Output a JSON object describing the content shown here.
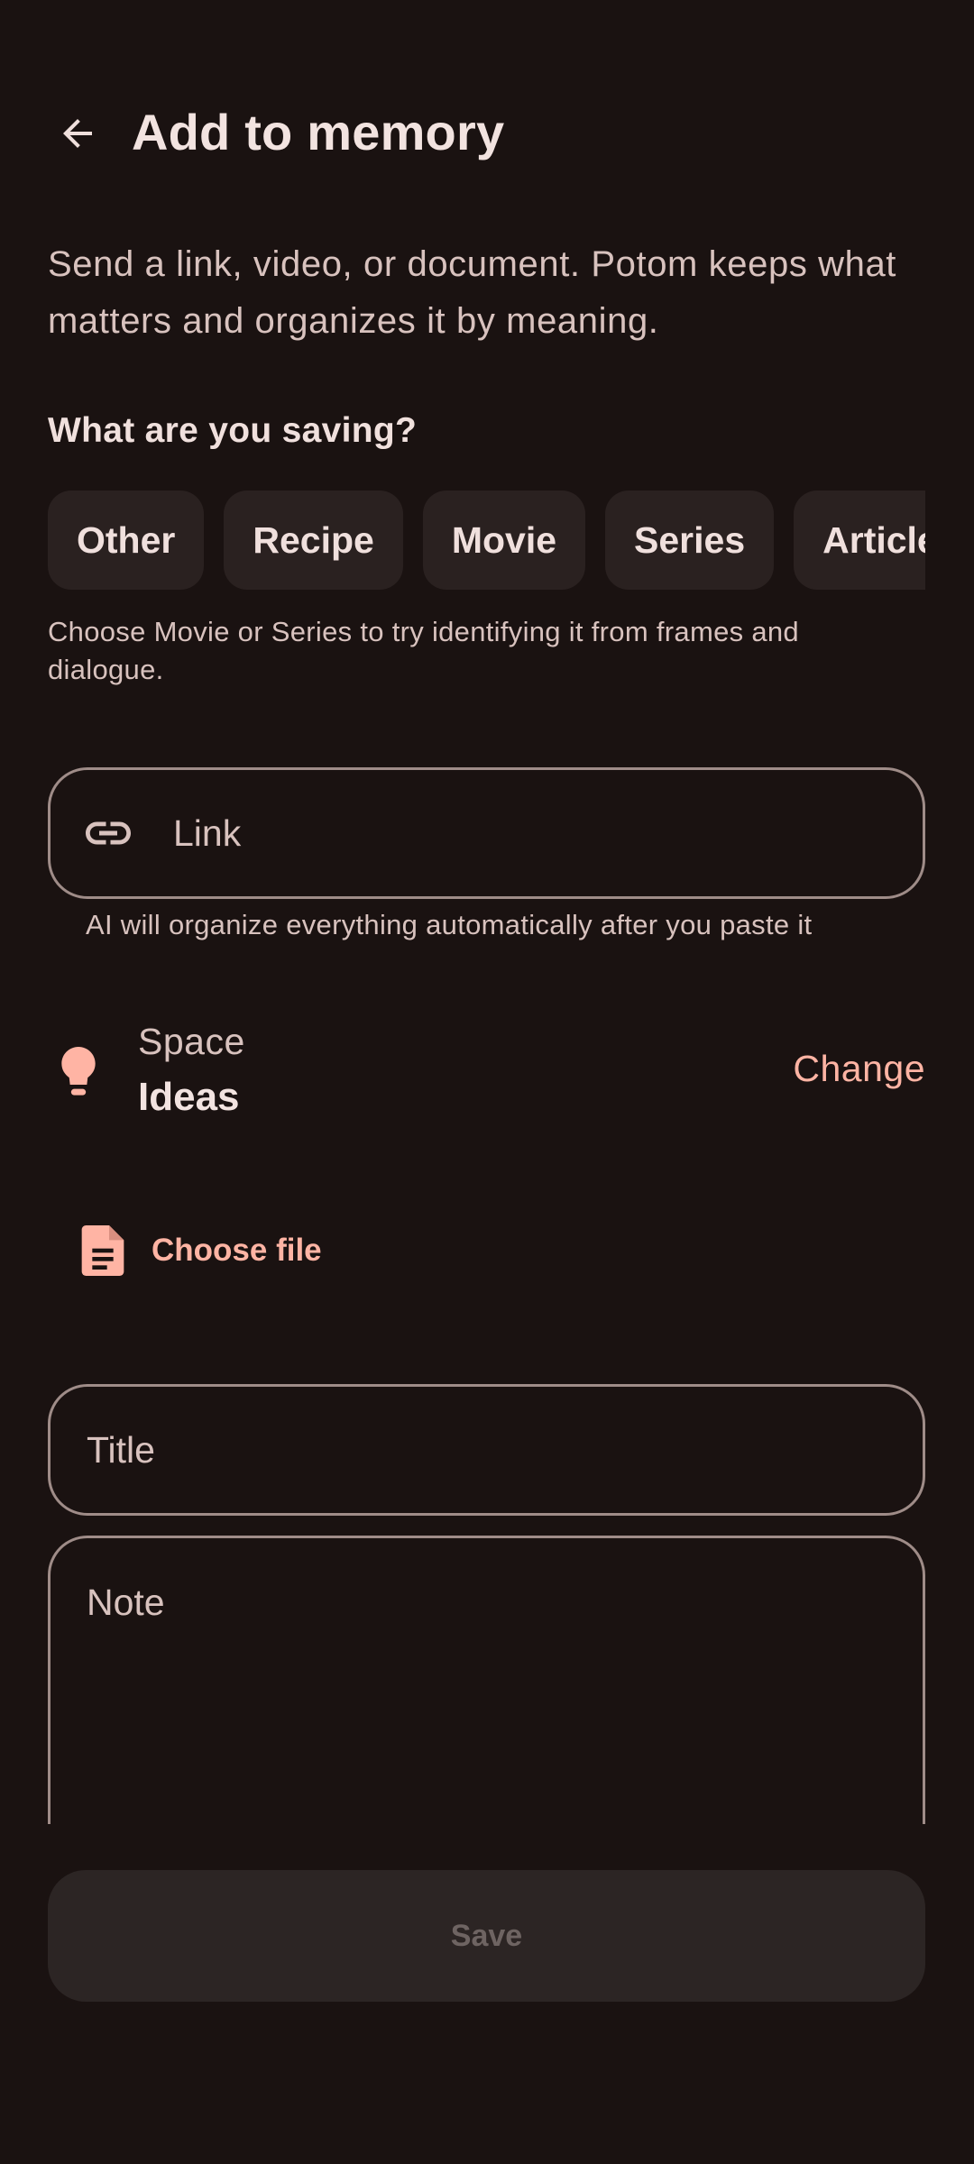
{
  "header": {
    "title": "Add to memory"
  },
  "intro": {
    "text": "Send a link, video, or document. Potom keeps what matters and organizes it by meaning."
  },
  "type_picker": {
    "label": "What are you saving?",
    "chips": [
      "Other",
      "Recipe",
      "Movie",
      "Series",
      "Article"
    ],
    "helper": "Choose Movie or Series to try identifying it from frames and dialogue."
  },
  "link_field": {
    "placeholder": "Link",
    "value": "",
    "supporting_text": "AI will organize everything automatically after you paste it"
  },
  "space": {
    "label": "Space",
    "value": "Ideas",
    "change_label": "Change"
  },
  "file": {
    "choose_label": "Choose file"
  },
  "title_field": {
    "placeholder": "Title",
    "value": ""
  },
  "note_field": {
    "placeholder": "Note",
    "value": ""
  },
  "save": {
    "label": "Save"
  },
  "colors": {
    "background": "#1a1211",
    "accent": "#ffb4a4",
    "chip_background": "#2a2120",
    "outline": "#9f8c88",
    "disabled_button": "#2c2524"
  },
  "icons": {
    "back": "arrow-back-icon",
    "link": "link-icon",
    "space": "lightbulb-icon",
    "file": "document-icon"
  }
}
